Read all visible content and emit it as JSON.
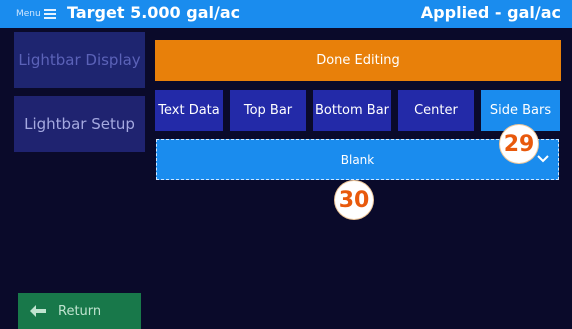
{
  "header": {
    "menu_label": "Menu",
    "title_left": "Target 5.000 gal/ac",
    "title_right": "Applied - gal/ac"
  },
  "sidebar": {
    "items": [
      {
        "label": "Lightbar Display"
      },
      {
        "label": "Lightbar Setup"
      }
    ],
    "return_label": "Return"
  },
  "main": {
    "done_label": "Done Editing",
    "tabs": [
      {
        "label": "Text Data"
      },
      {
        "label": "Top Bar"
      },
      {
        "label": "Bottom Bar"
      },
      {
        "label": "Center"
      },
      {
        "label": "Side Bars"
      }
    ],
    "dropdown_value": "Blank"
  },
  "annotations": [
    {
      "number": "29"
    },
    {
      "number": "30"
    }
  ],
  "colors": {
    "header_bg": "#1a8cee",
    "background": "#0a0a2a",
    "accent_orange": "#e8800a",
    "tab_bg": "#232aa8",
    "tab_active_bg": "#1a8cee",
    "return_bg": "#18784a"
  }
}
